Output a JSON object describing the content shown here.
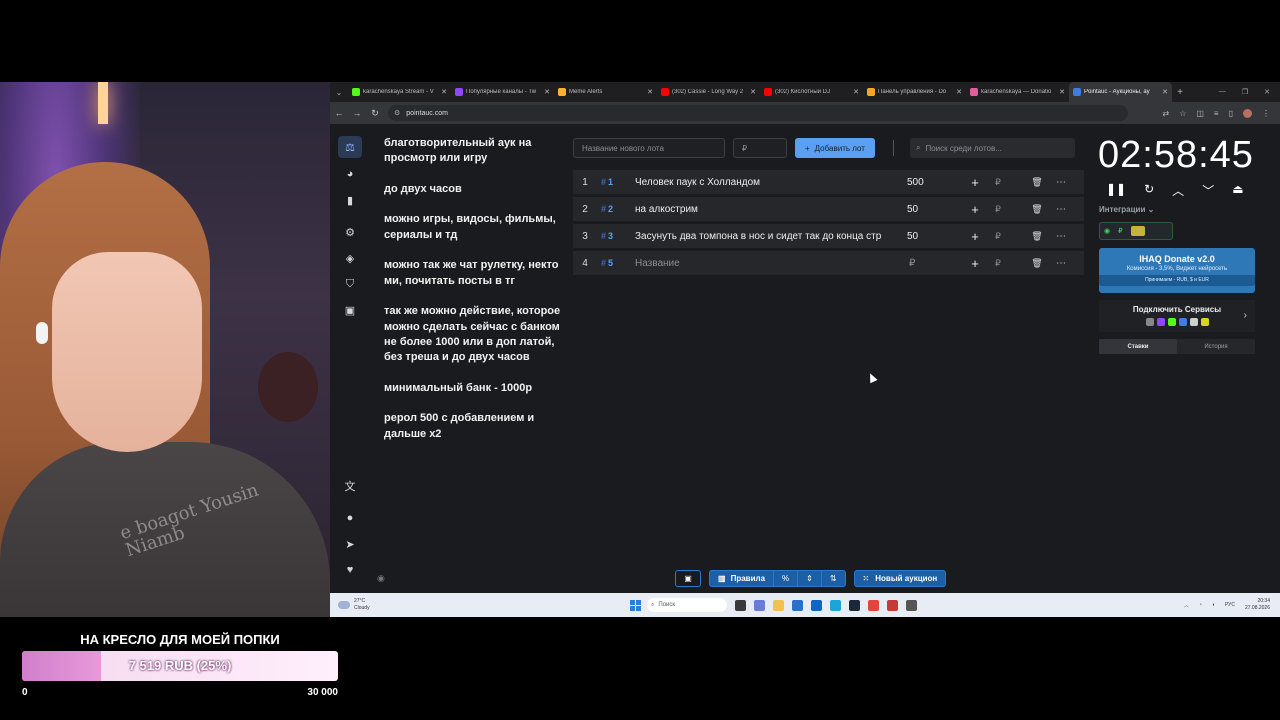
{
  "goal": {
    "title": "НА КРЕСЛО ДЛЯ МОЕЙ ПОПКИ",
    "progress_label": "7 519 RUB (25%)",
    "progress": 0.25,
    "min": "0",
    "max": "30 000"
  },
  "shirt_text": "e boagot Yousin Niamb",
  "browser": {
    "tabs": [
      {
        "label": "karachenskaya Stream - V",
        "color": "#53fc18"
      },
      {
        "label": "Популярные каналы - Tw",
        "color": "#9146ff"
      },
      {
        "label": "Meme Alerts",
        "color": "#ffb02e"
      },
      {
        "label": "(302) Cassie - Long Way 2",
        "color": "#ff0000"
      },
      {
        "label": "(302) Кислотный DJ",
        "color": "#ff0000"
      },
      {
        "label": "Панель управления - Do",
        "color": "#f5a623"
      },
      {
        "label": "karachenskaya — Donatio",
        "color": "#e05f9b"
      },
      {
        "label": "Pointauc - Аукционы, ау",
        "color": "#3f7de0"
      }
    ],
    "url": "pointauc.com"
  },
  "notes": [
    "благотворительный аук на просмотр или игру",
    "до  двух часов",
    "можно игры, видосы, фильмы, сериалы и тд",
    "можно так же чат рулетку, некто ми, почитать посты в тг",
    "так же можно действие, которое можно сделать сейчас с банком не более 1000 или в доп латой, без треша  и до двух часов",
    "минимальный банк - 1000р",
    "рерол 500 с добавлением и дальше х2"
  ],
  "toolbar": {
    "lot_placeholder": "Название нового лота",
    "amount_placeholder": "₽",
    "add_label": "Добавить лот",
    "search_placeholder": "Поиск среди лотов..."
  },
  "lots": [
    {
      "num": "1",
      "tag": "1",
      "name": "Человек паук с Холландом",
      "amount": "500"
    },
    {
      "num": "2",
      "tag": "2",
      "name": "на алкострим",
      "amount": "50"
    },
    {
      "num": "3",
      "tag": "3",
      "name": "Засунуть два томпона в нос и сидет так до конца стр",
      "amount": "50"
    },
    {
      "num": "4",
      "tag": "5",
      "name": "Название",
      "amount": "₽"
    }
  ],
  "currency": "₽",
  "timer": "02:58:45",
  "integrations_label": "Интеграции",
  "donate": {
    "title": "IHAQ Donate v2.0",
    "subtitle": "Комиссия - 3,5%, Виджет нейросеть",
    "footer": "Принимаем - RUB, $ и EUR"
  },
  "connect_label": "Подключить Сервисы",
  "history_tabs": {
    "bets": "Ставки",
    "history": "История"
  },
  "bottom": {
    "rules": "Правила",
    "new_auction": "Новый аукцион"
  },
  "taskbar": {
    "weather_temp": "27°C",
    "weather_desc": "Cloudy",
    "search": "Поиск",
    "lang": "РУС",
    "time": "20:34",
    "date": "27.08.2026"
  }
}
